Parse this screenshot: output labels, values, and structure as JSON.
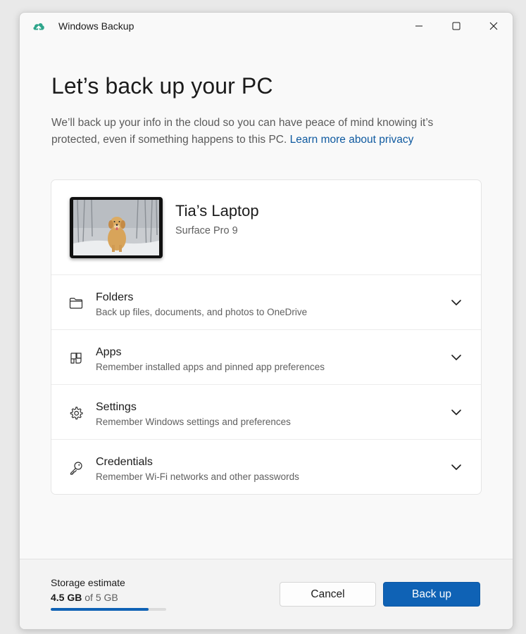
{
  "window": {
    "title": "Windows Backup",
    "controls": {
      "minimize": "minimize-icon",
      "maximize": "maximize-icon",
      "close": "close-icon"
    }
  },
  "main": {
    "heading": "Let’s back up your PC",
    "description": "We’ll back up your info in the cloud so you can have peace of mind knowing it’s protected, even if something happens to this PC.",
    "privacy_link": "Learn more about privacy"
  },
  "device": {
    "name": "Tia’s Laptop",
    "model": "Surface Pro 9"
  },
  "options": [
    {
      "title": "Folders",
      "subtitle": "Back up files, documents, and photos to OneDrive",
      "icon": "folder-icon"
    },
    {
      "title": "Apps",
      "subtitle": "Remember installed apps and pinned app preferences",
      "icon": "apps-icon"
    },
    {
      "title": "Settings",
      "subtitle": "Remember Windows settings and preferences",
      "icon": "gear-icon"
    },
    {
      "title": "Credentials",
      "subtitle": "Remember Wi-Fi networks and other passwords",
      "icon": "key-icon"
    }
  ],
  "footer": {
    "storage_label": "Storage estimate",
    "storage_used": "4.5 GB",
    "storage_total_text": "of 5 GB",
    "storage_fraction": 0.85,
    "cancel_label": "Cancel",
    "backup_label": "Back up"
  },
  "colors": {
    "accent": "#0f62b5",
    "link": "#0f5aa0",
    "app_icon": "#2ea58b"
  }
}
